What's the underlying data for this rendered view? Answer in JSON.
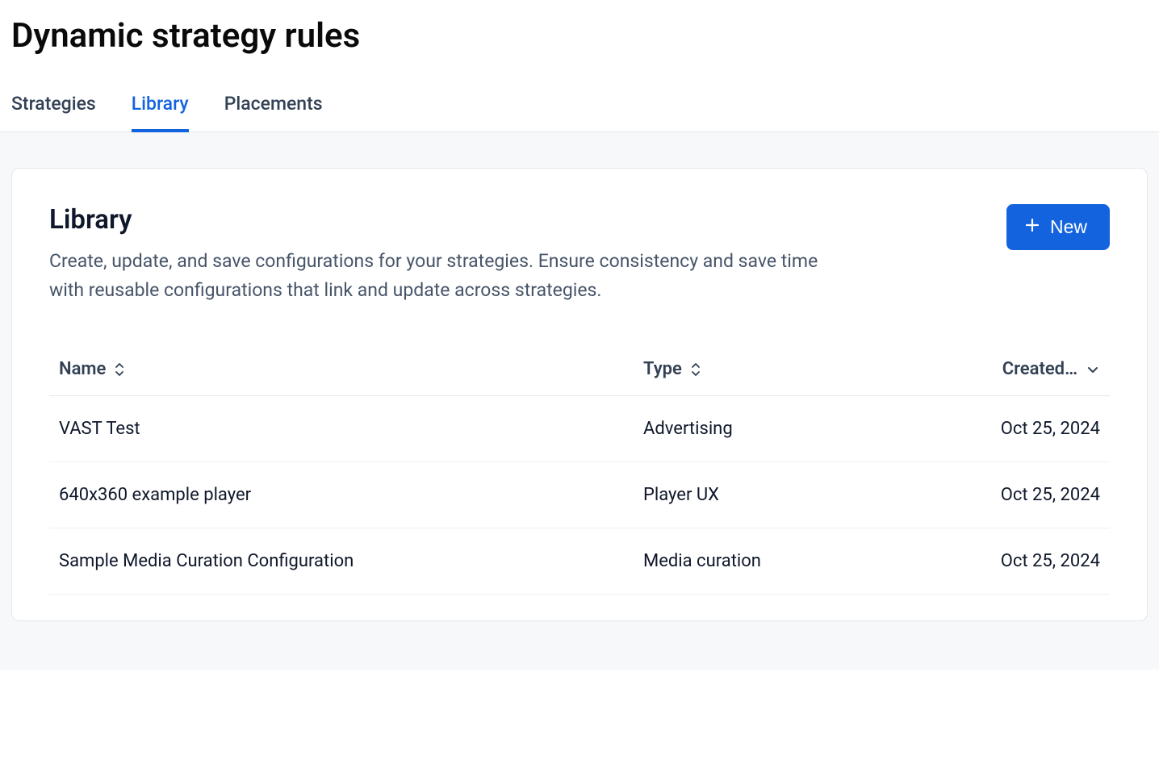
{
  "pageTitle": "Dynamic strategy rules",
  "tabs": [
    {
      "label": "Strategies",
      "active": false
    },
    {
      "label": "Library",
      "active": true
    },
    {
      "label": "Placements",
      "active": false
    }
  ],
  "library": {
    "title": "Library",
    "description": "Create, update, and save configurations for your strategies. Ensure consistency and save time with reusable configurations that link and update across strategies.",
    "newButton": "New",
    "columns": {
      "name": "Name",
      "type": "Type",
      "created": "Created…"
    },
    "rows": [
      {
        "name": "VAST Test",
        "type": "Advertising",
        "created": "Oct 25, 2024"
      },
      {
        "name": "640x360 example player",
        "type": "Player UX",
        "created": "Oct 25, 2024"
      },
      {
        "name": "Sample Media Curation Configuration",
        "type": "Media curation",
        "created": "Oct 25, 2024"
      }
    ]
  }
}
